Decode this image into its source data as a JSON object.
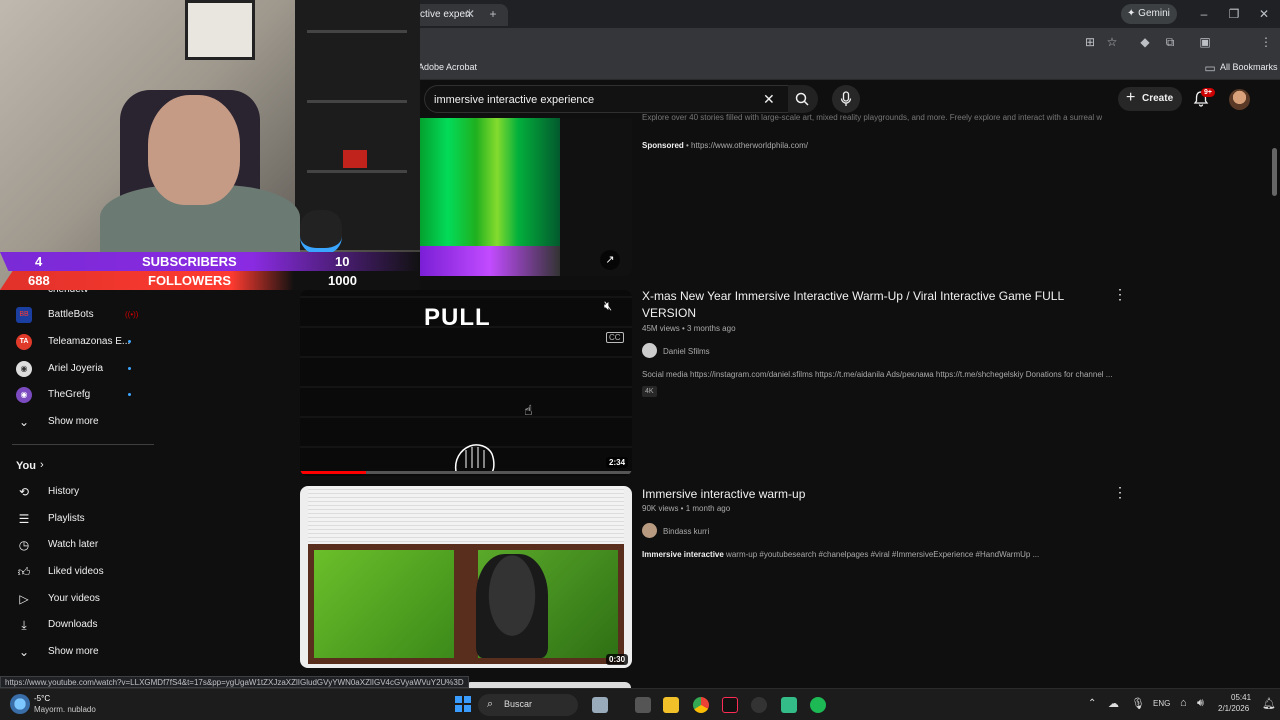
{
  "browser": {
    "tab_title": "ctive experi",
    "gemini_label": "Gemini",
    "bookmark_acrobat": "Adobe Acrobat",
    "all_bookmarks": "All Bookmarks"
  },
  "youtube": {
    "search_value": "immersive interactive experience",
    "create_label": "Create",
    "notif_badge": "9+"
  },
  "webcam": {
    "subs_count": "4",
    "subs_label": "SUBSCRIBERS",
    "subs_goal": "10",
    "followers_count": "688",
    "followers_label": "FOLLOWERS",
    "followers_goal": "1000"
  },
  "sidebar": {
    "partial_top": "chendetv",
    "subscriptions": [
      {
        "label": "BattleBots"
      },
      {
        "label": "Teleamazonas E..."
      },
      {
        "label": "Ariel Joyeria"
      },
      {
        "label": "TheGrefg"
      }
    ],
    "show_more_1": "Show more",
    "you_label": "You",
    "you_items": [
      {
        "label": "History"
      },
      {
        "label": "Playlists"
      },
      {
        "label": "Watch later"
      },
      {
        "label": "Liked videos"
      },
      {
        "label": "Your videos"
      },
      {
        "label": "Downloads"
      }
    ],
    "show_more_2": "Show more"
  },
  "results": {
    "sponsored": {
      "desc": "Explore over 40 stories filled with large-scale art, mixed reality playgrounds, and more. Freely explore and interact with a surreal world...",
      "sponsored_label": "Sponsored",
      "url": "https://www.otherworldphila.com/"
    },
    "video1": {
      "title": "X-mas New Year Immersive Interactive Warm-Up / Viral Interactive Game FULL VERSION",
      "meta": "45M views • 3 months ago",
      "channel": "Daniel Sfilms",
      "desc": "Social media https://instagram.com/daniel.sfilms https://t.me/aidanila Ads/реклама https://t.me/shchegelskiy Donations for channel ...",
      "badge": "4K",
      "duration": "2:34",
      "overlay_text": "PULL",
      "progress": 0.2
    },
    "video2": {
      "title": "Immersive interactive warm-up",
      "meta": "90K views • 1 month ago",
      "channel": "Bindass kurri",
      "desc_bold": "Immersive interactive",
      "desc": " warm-up #youtubesearch #chanelpages #viral #ImmersiveExperience #HandWarmUp ...",
      "duration": "0:30"
    }
  },
  "status_url": "https://www.youtube.com/watch?v=LLXGMDf7fS4&t=17s&pp=ygUgaW1tZXJzaXZlIGludGVyYWN0aXZlIGV4cGVyaWVuY2U%3D",
  "taskbar": {
    "weather_temp": "-5°C",
    "weather_desc": "Mayorm. nublado",
    "search_label": "Buscar",
    "lang": "ENG",
    "time": "05:41",
    "date": "2/1/2026"
  },
  "colors": {
    "accent_red": "#ff0000",
    "sub_banner": "#8a2be2",
    "followers_banner": "#ff3b30",
    "link_blue": "#3ea6ff"
  }
}
